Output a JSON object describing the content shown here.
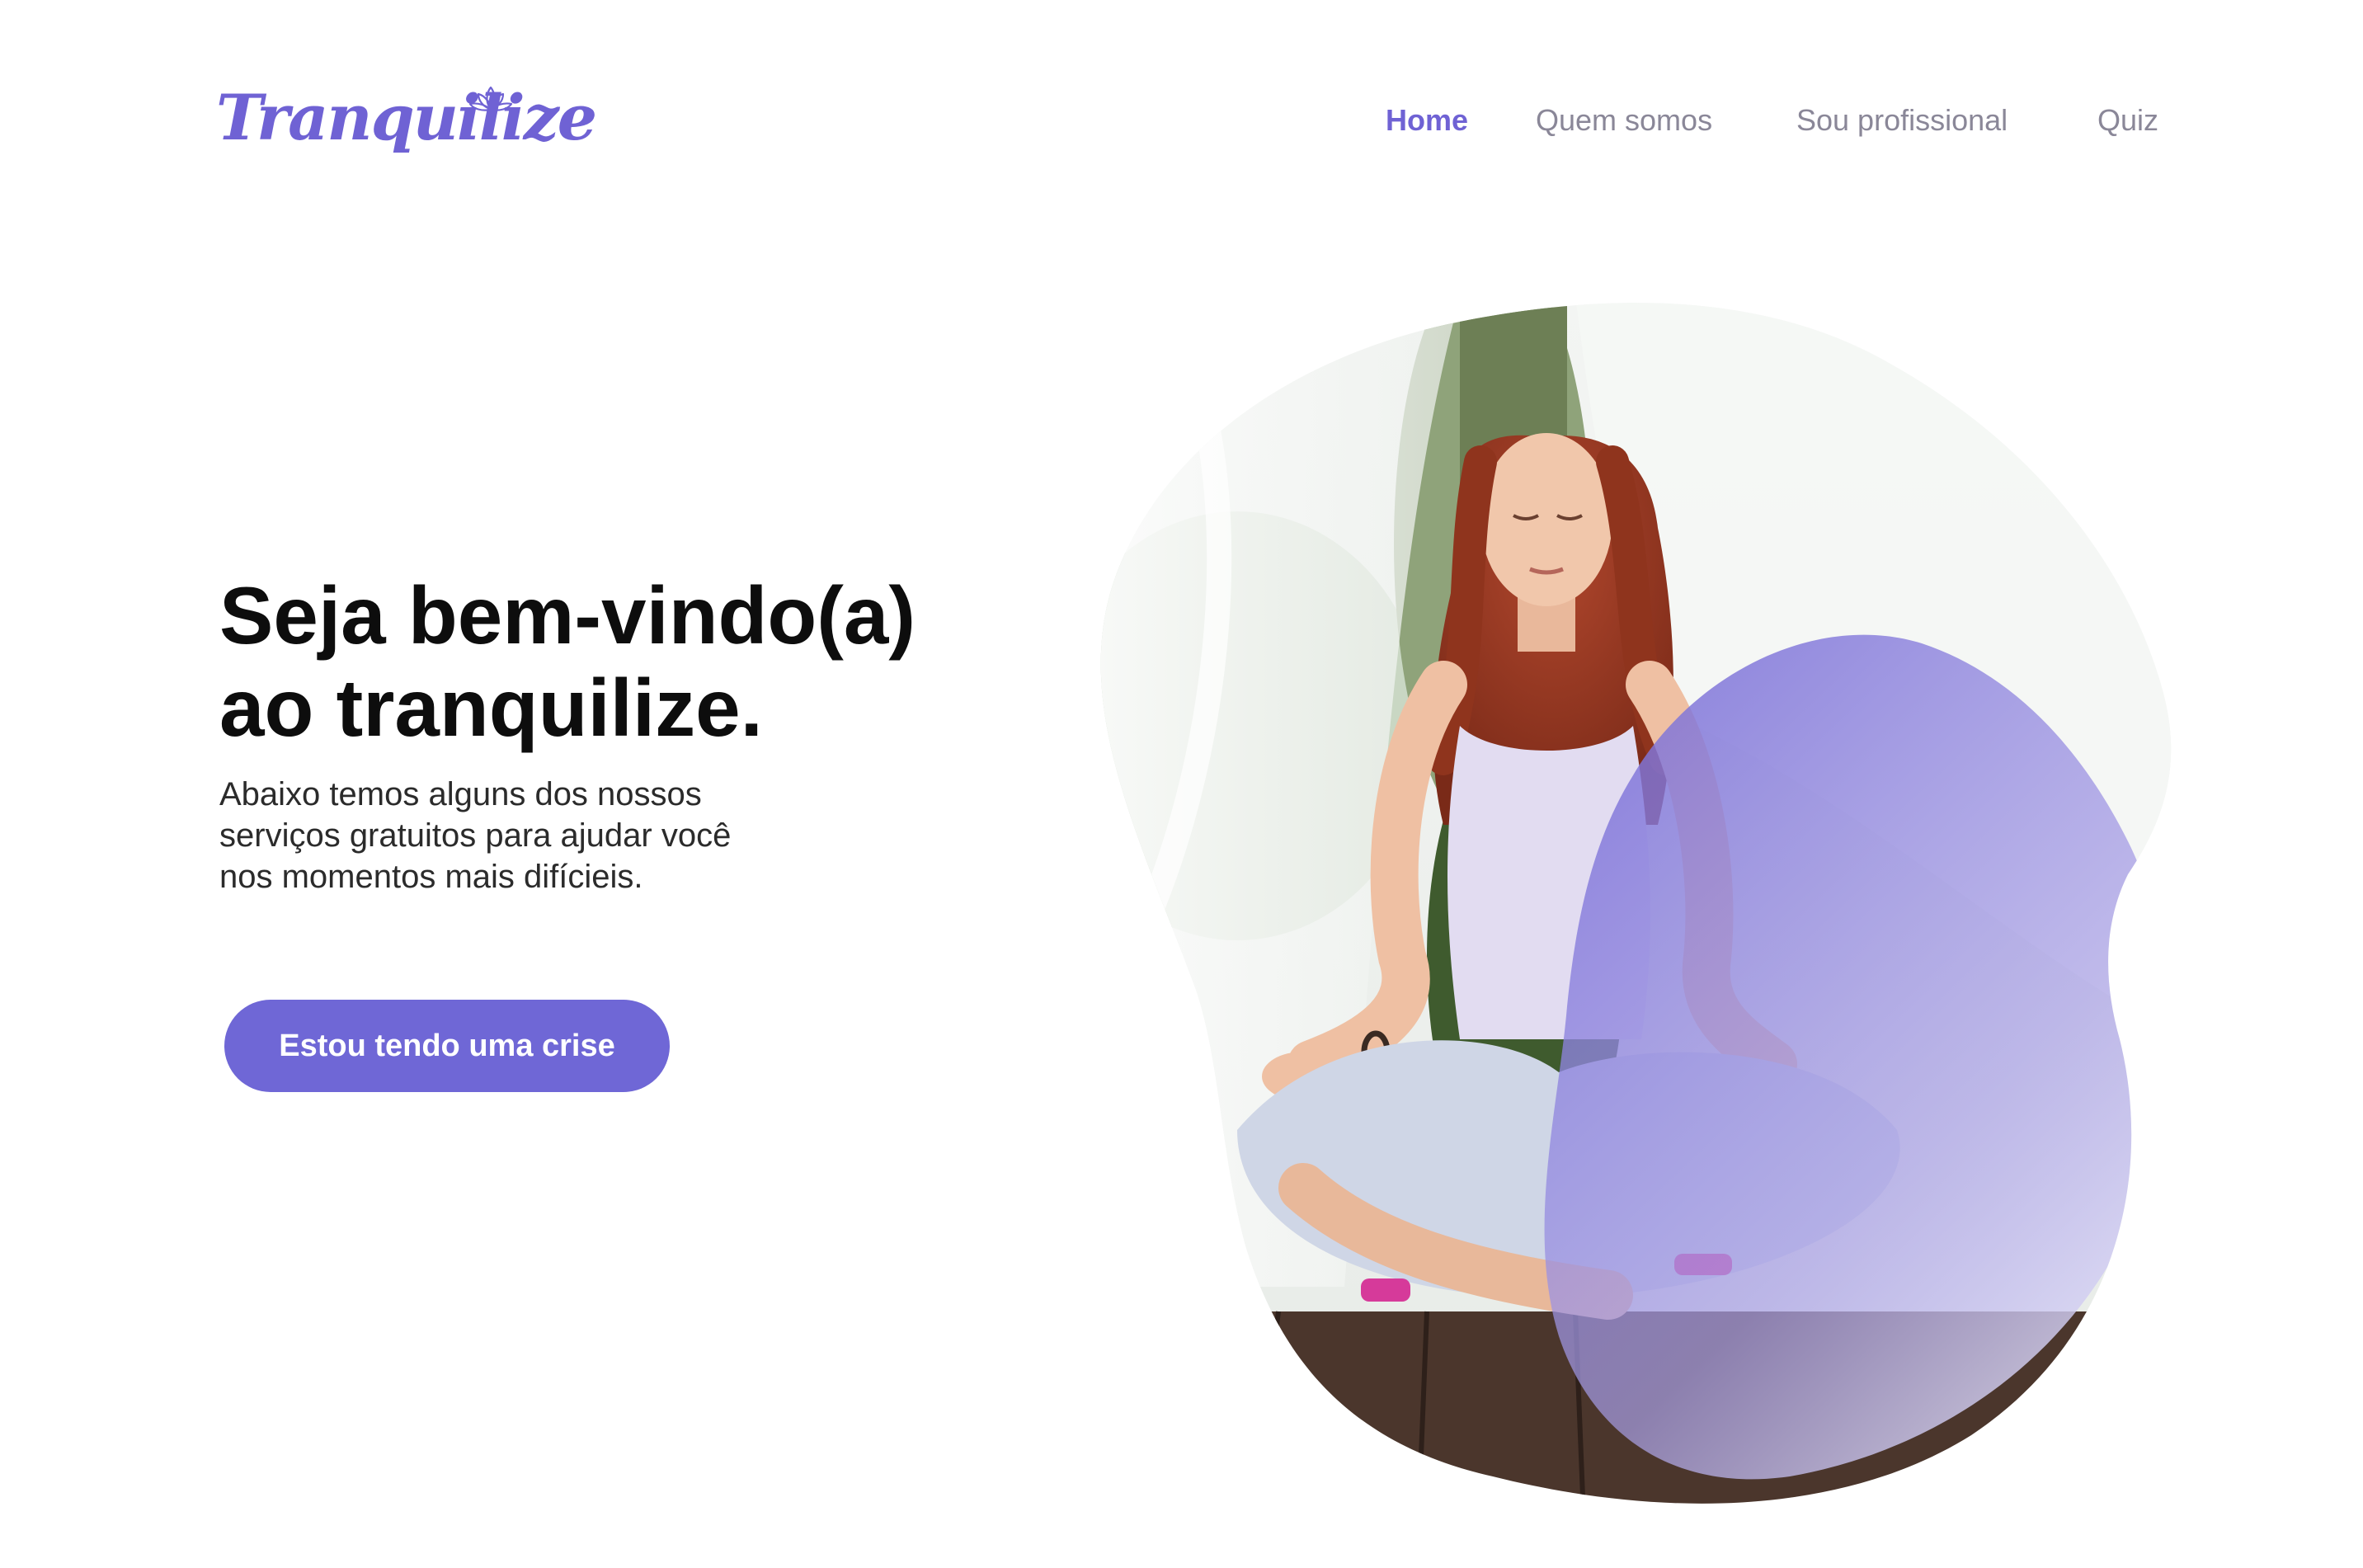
{
  "brand": {
    "name": "Tranquilize",
    "color": "#6f62d4",
    "logo_icon": "lotus-icon"
  },
  "nav": {
    "items": [
      {
        "label": "Home",
        "active": true
      },
      {
        "label": "Quem somos",
        "active": false
      },
      {
        "label": "Sou profissional",
        "active": false
      },
      {
        "label": "Quiz",
        "active": false
      }
    ]
  },
  "hero": {
    "title_line1": "Seja bem-vindo(a)",
    "title_line2": "ao tranquilize.",
    "subtitle_line1": "Abaixo temos alguns dos nossos",
    "subtitle_line2": "serviços gratuitos para ajudar você",
    "subtitle_line3": "nos momentos mais difícieis.",
    "cta_label": "Estou tendo uma crise",
    "cta_color": "#6f67d6",
    "image": "woman-meditating-illustration"
  }
}
